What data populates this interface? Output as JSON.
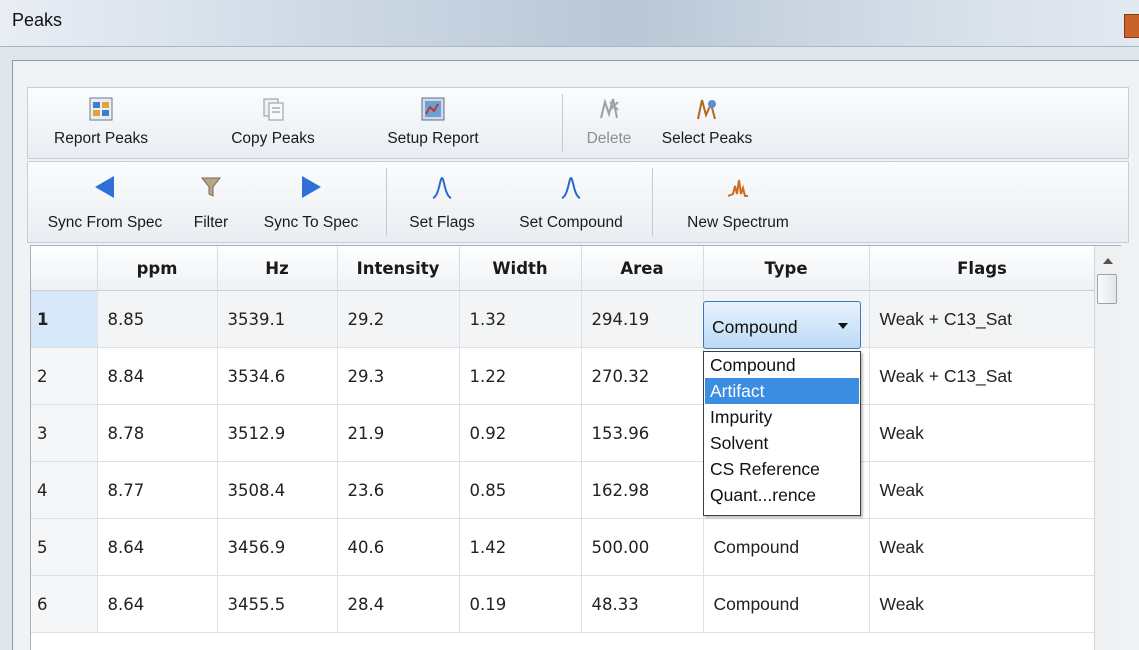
{
  "window": {
    "title": "Peaks"
  },
  "toolbar1": [
    {
      "label": "Report Peaks",
      "icon": "report-peaks-icon",
      "dropdown": true,
      "enabled": true
    },
    {
      "label": "Copy Peaks",
      "icon": "copy-peaks-icon",
      "dropdown": true,
      "enabled": true
    },
    {
      "label": "Setup Report",
      "icon": "setup-report-icon",
      "dropdown": true,
      "enabled": true
    },
    {
      "label": "Delete",
      "icon": "delete-icon",
      "dropdown": false,
      "enabled": false
    },
    {
      "label": "Select Peaks",
      "icon": "select-peaks-icon",
      "dropdown": false,
      "enabled": true
    }
  ],
  "toolbar2": [
    {
      "label": "Sync From Spec",
      "icon": "arrow-left-icon"
    },
    {
      "label": "Filter",
      "icon": "filter-icon"
    },
    {
      "label": "Sync To Spec",
      "icon": "arrow-right-icon"
    },
    {
      "label": "Set Flags",
      "icon": "set-flags-icon"
    },
    {
      "label": "Set Compound",
      "icon": "set-compound-icon"
    },
    {
      "label": "New Spectrum",
      "icon": "new-spectrum-icon"
    }
  ],
  "table": {
    "columns": [
      "",
      "ppm",
      "Hz",
      "Intensity",
      "Width",
      "Area",
      "Type",
      "Flags"
    ],
    "rows": [
      {
        "n": "1",
        "ppm": "8.85",
        "hz": "3539.1",
        "intensity": "29.2",
        "width": "1.32",
        "area": "294.19",
        "type": "Compound",
        "flags": "Weak + C13_Sat"
      },
      {
        "n": "2",
        "ppm": "8.84",
        "hz": "3534.6",
        "intensity": "29.3",
        "width": "1.22",
        "area": "270.32",
        "type": "",
        "flags": "Weak + C13_Sat"
      },
      {
        "n": "3",
        "ppm": "8.78",
        "hz": "3512.9",
        "intensity": "21.9",
        "width": "0.92",
        "area": "153.96",
        "type": "",
        "flags": "Weak"
      },
      {
        "n": "4",
        "ppm": "8.77",
        "hz": "3508.4",
        "intensity": "23.6",
        "width": "0.85",
        "area": "162.98",
        "type": "",
        "flags": "Weak"
      },
      {
        "n": "5",
        "ppm": "8.64",
        "hz": "3456.9",
        "intensity": "40.6",
        "width": "1.42",
        "area": "500.00",
        "type": "Compound",
        "flags": "Weak"
      },
      {
        "n": "6",
        "ppm": "8.64",
        "hz": "3455.5",
        "intensity": "28.4",
        "width": "0.19",
        "area": "48.33",
        "type": "Compound",
        "flags": "Weak"
      }
    ]
  },
  "type_combo": {
    "selected": "Compound",
    "options": [
      "Compound",
      "Artifact",
      "Impurity",
      "Solvent",
      "CS Reference",
      "Quant...rence"
    ],
    "highlighted_index": 1
  },
  "colors": {
    "accent": "#3a8de0",
    "selected_row_header": "#d7e9f8"
  }
}
